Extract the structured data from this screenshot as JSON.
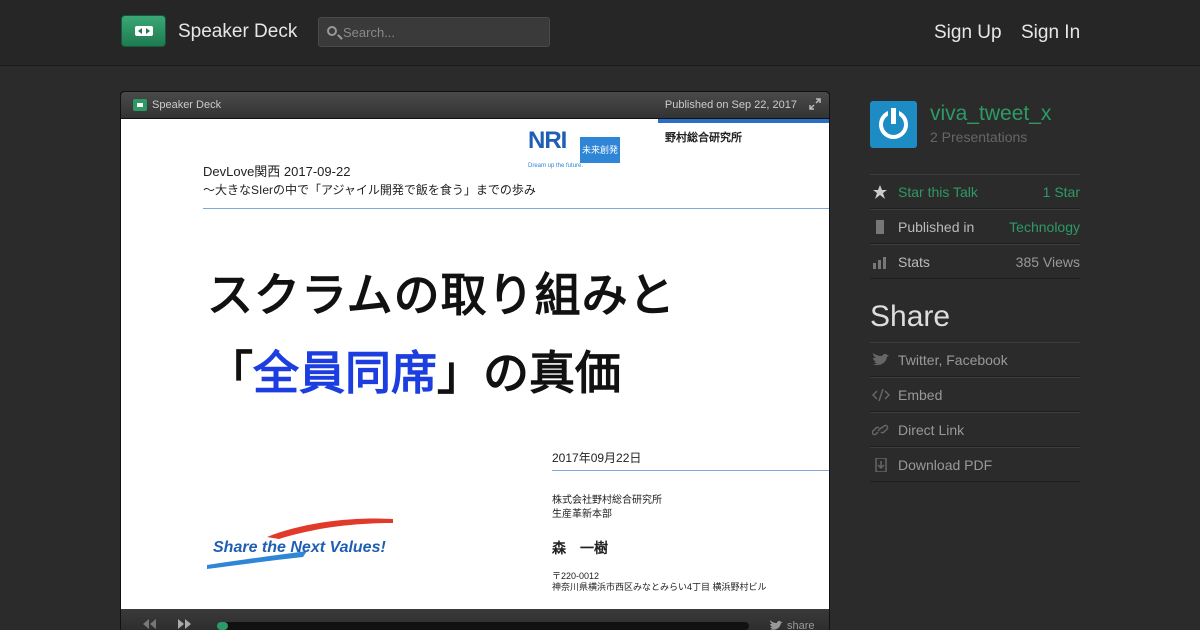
{
  "header": {
    "brand": "Speaker Deck",
    "search_placeholder": "Search...",
    "sign_up": "Sign Up",
    "sign_in": "Sign In"
  },
  "player": {
    "brand": "Speaker Deck",
    "published": "Published on Sep 22, 2017",
    "share_label": "share",
    "progress_fraction": 0.02
  },
  "slide": {
    "event_title": "DevLove関西 2017-09-22",
    "event_subtitle": "～大きなSIerの中で「アジャイル開発で飯を食う」までの歩み",
    "company_top": "野村総合研究所",
    "nri_letters": "NRI",
    "nri_box": "未来創発",
    "nri_tagline": "Dream up the future.",
    "title_line1": "スクラムの取り組みと",
    "title_line2_open": "「",
    "title_line2_accent": "全員同席",
    "title_line2_rest": "」の真価",
    "date": "2017年09月22日",
    "org_line1": "株式会社野村総合研究所",
    "org_line2": "生産革新本部",
    "presenter": "森　一樹",
    "postal": "〒220-0012",
    "address": "神奈川県横浜市西区みなとみらい4丁目 横浜野村ビル",
    "tagline": "Share the Next Values!"
  },
  "sidebar": {
    "username": "viva_tweet_x",
    "presentations": "2 Presentations",
    "star_label": "Star this Talk",
    "star_value": "1 Star",
    "published_label": "Published in",
    "published_value": "Technology",
    "stats_label": "Stats",
    "stats_value": "385 Views",
    "share_heading": "Share",
    "share_items": [
      "Twitter, Facebook",
      "Embed",
      "Direct Link",
      "Download PDF"
    ]
  },
  "colors": {
    "accent": "#2d9a66",
    "background": "#2b2b2b",
    "slide_blue": "#1c3de0"
  }
}
